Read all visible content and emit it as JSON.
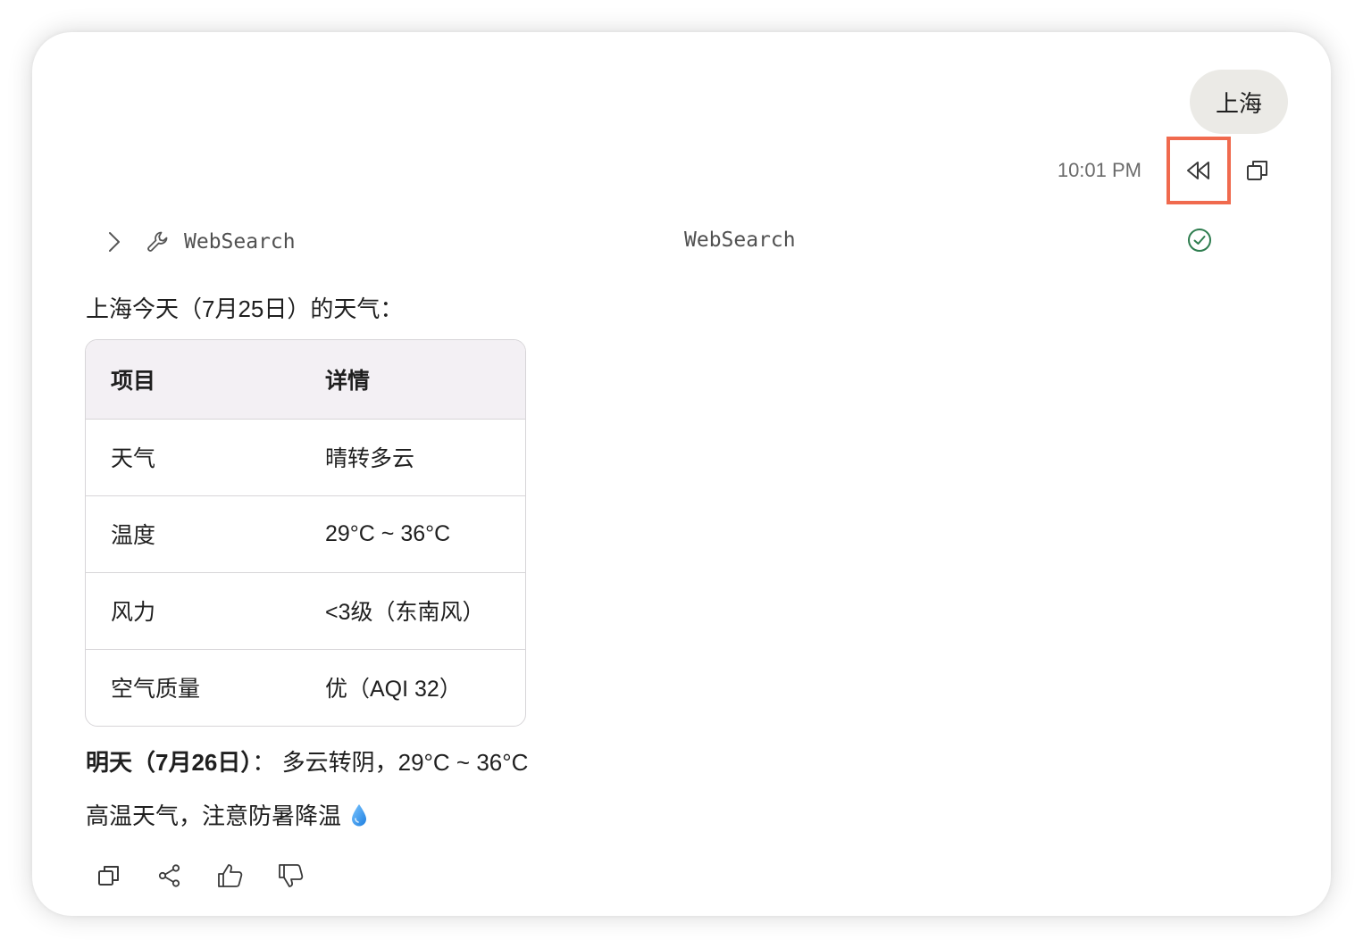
{
  "user_message": {
    "text": "上海"
  },
  "meta": {
    "timestamp": "10:01 PM"
  },
  "tool_call": {
    "name": "WebSearch",
    "title": "WebSearch",
    "status": "success",
    "status_color": "#2e7d4f"
  },
  "reply": {
    "intro": "上海今天（7月25日）的天气：",
    "table": {
      "headers": [
        "项目",
        "详情"
      ],
      "rows": [
        [
          "天气",
          "晴转多云"
        ],
        [
          "温度",
          "29°C ~ 36°C"
        ],
        [
          "风力",
          "<3级（东南风）"
        ],
        [
          "空气质量",
          "优（AQI 32）"
        ]
      ]
    },
    "tomorrow_label": "明天（7月26日）",
    "tomorrow_text": "： 多云转阴，29°C ~ 36°C",
    "advice": "高温天气，注意防暑降温"
  },
  "colors": {
    "highlight_border": "#f06a4e",
    "bubble_bg": "#ebeae6",
    "table_header_bg": "#f3f0f4"
  },
  "icons": {
    "rewind": "rewind-icon",
    "copy": "copy-icon",
    "expand": "chevron-right-icon",
    "tool": "wrench-icon",
    "status": "check-circle-icon",
    "drop": "droplet-icon",
    "share": "share-icon",
    "like": "thumbs-up-icon",
    "dislike": "thumbs-down-icon"
  }
}
